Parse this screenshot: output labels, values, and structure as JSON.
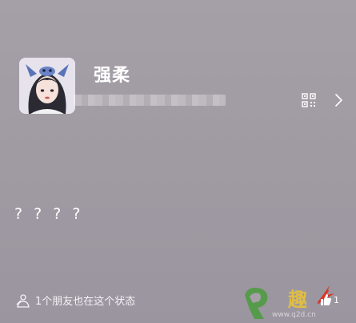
{
  "profile": {
    "name": "强柔",
    "avatar_icon": "girl-avatar-with-stitch-headband"
  },
  "header": {
    "qr_icon": "qr-code-icon",
    "chevron_icon": "chevron-right-icon"
  },
  "status": {
    "text": "? ? ? ?"
  },
  "footer": {
    "friends_text": "1个朋友也在这个状态",
    "like_count": "1"
  },
  "watermark": {
    "text": "趣",
    "url": "www.q2d.cn"
  },
  "colors": {
    "background": "#a39ea6",
    "text": "#ffffff",
    "watermark_green": "#4a9c3c",
    "watermark_yellow": "#e8c33a",
    "arrow_red": "#d9352a"
  }
}
